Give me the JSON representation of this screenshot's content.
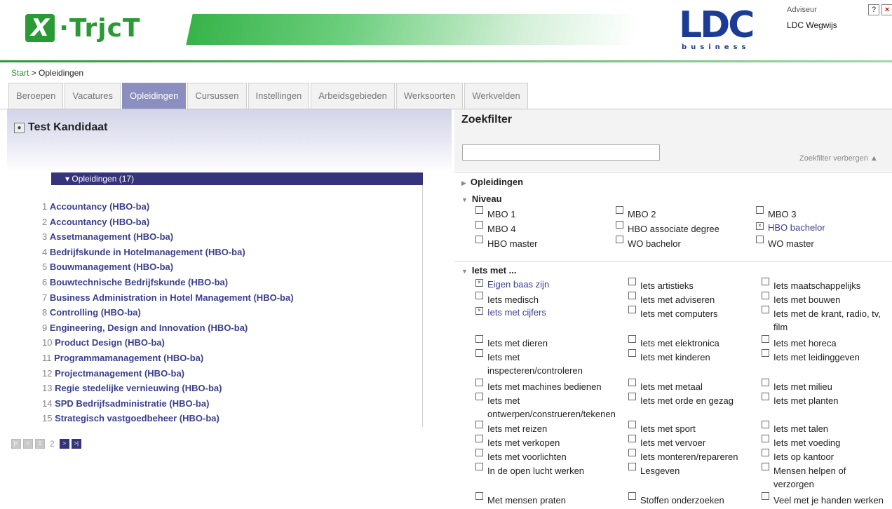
{
  "header": {
    "logo_mark": "X",
    "logo_text": "·TrjcT",
    "partner_logo": "LDC",
    "partner_sub": "business",
    "adviseur_label": "Adviseur",
    "adviseur_name": "LDC Wegwijs",
    "help_label": "?",
    "close_label": "×"
  },
  "breadcrumb": {
    "start": "Start",
    "sep": " > ",
    "current": "Opleidingen"
  },
  "tabs": [
    "Beroepen",
    "Vacatures",
    "Opleidingen",
    "Cursussen",
    "Instellingen",
    "Arbeidsgebieden",
    "Werksoorten",
    "Werkvelden"
  ],
  "active_tab": "Opleidingen",
  "candidate": {
    "name": "Test Kandidaat"
  },
  "results": {
    "header": "▾ Opleidingen (17)",
    "items": [
      {
        "n": "1",
        "label": "Accountancy (HBO-ba)"
      },
      {
        "n": "2",
        "label": "Accountancy (HBO-ba)"
      },
      {
        "n": "3",
        "label": "Assetmanagement (HBO-ba)"
      },
      {
        "n": "4",
        "label": "Bedrijfskunde in Hotelmanagement (HBO-ba)"
      },
      {
        "n": "5",
        "label": "Bouwmanagement (HBO-ba)"
      },
      {
        "n": "6",
        "label": "Bouwtechnische Bedrijfskunde (HBO-ba)"
      },
      {
        "n": "7",
        "label": "Business Administration in Hotel Management (HBO-ba)"
      },
      {
        "n": "8",
        "label": "Controlling (HBO-ba)"
      },
      {
        "n": "9",
        "label": "Engineering, Design and Innovation (HBO-ba)"
      },
      {
        "n": "10",
        "label": "Product Design (HBO-ba)"
      },
      {
        "n": "11",
        "label": "Programmamanagement (HBO-ba)"
      },
      {
        "n": "12",
        "label": "Projectmanagement (HBO-ba)"
      },
      {
        "n": "13",
        "label": "Regie stedelijke vernieuwing (HBO-ba)"
      },
      {
        "n": "14",
        "label": "SPD Bedrijfsadministratie (HBO-ba)"
      },
      {
        "n": "15",
        "label": "Strategisch vastgoedbeheer (HBO-ba)"
      }
    ]
  },
  "pager": {
    "page1": "1",
    "page2": "2"
  },
  "zoekfilter": {
    "title": "Zoekfilter",
    "search_value": "",
    "hide_label": "Zoekfilter verbergen",
    "sections": {
      "opleidingen": "Opleidingen",
      "niveau": "Niveau",
      "iets_met": "Iets met ..."
    },
    "niveau": [
      {
        "label": "MBO 1",
        "checked": false
      },
      {
        "label": "MBO 2",
        "checked": false
      },
      {
        "label": "MBO 3",
        "checked": false
      },
      {
        "label": "MBO 4",
        "checked": false
      },
      {
        "label": "HBO associate degree",
        "checked": false
      },
      {
        "label": "HBO bachelor",
        "checked": true
      },
      {
        "label": "HBO master",
        "checked": false
      },
      {
        "label": "WO bachelor",
        "checked": false
      },
      {
        "label": "WO master",
        "checked": false
      }
    ],
    "iets_met": [
      {
        "label": "Eigen baas zijn",
        "checked": true
      },
      {
        "label": "Iets artistieks",
        "checked": false
      },
      {
        "label": "Iets maatschappelijks",
        "checked": false
      },
      {
        "label": "Iets medisch",
        "checked": false
      },
      {
        "label": "Iets met adviseren",
        "checked": false
      },
      {
        "label": "Iets met bouwen",
        "checked": false
      },
      {
        "label": "Iets met cijfers",
        "checked": true
      },
      {
        "label": "Iets met computers",
        "checked": false
      },
      {
        "label": "Iets met de krant, radio, tv,",
        "label2": "film",
        "checked": false
      },
      {
        "label": "Iets met dieren",
        "checked": false
      },
      {
        "label": "Iets met elektronica",
        "checked": false
      },
      {
        "label": "Iets met horeca",
        "checked": false
      },
      {
        "label": "Iets met",
        "label2": "inspecteren/controleren",
        "checked": false
      },
      {
        "label": "Iets met kinderen",
        "checked": false
      },
      {
        "label": "Iets met leidinggeven",
        "checked": false
      },
      {
        "label": "Iets met machines bedienen",
        "checked": false
      },
      {
        "label": "Iets met metaal",
        "checked": false
      },
      {
        "label": "Iets met milieu",
        "checked": false
      },
      {
        "label": "Iets met",
        "label2": "ontwerpen/construeren/tekenen",
        "checked": false
      },
      {
        "label": "Iets met orde en gezag",
        "checked": false
      },
      {
        "label": "Iets met planten",
        "checked": false
      },
      {
        "label": "Iets met reizen",
        "checked": false
      },
      {
        "label": "Iets met sport",
        "checked": false
      },
      {
        "label": "Iets met talen",
        "checked": false
      },
      {
        "label": "Iets met verkopen",
        "checked": false
      },
      {
        "label": "Iets met vervoer",
        "checked": false
      },
      {
        "label": "Iets met voeding",
        "checked": false
      },
      {
        "label": "Iets met voorlichten",
        "checked": false
      },
      {
        "label": "Iets monteren/repareren",
        "checked": false
      },
      {
        "label": "Iets op kantoor",
        "checked": false
      },
      {
        "label": "In de open lucht werken",
        "checked": false
      },
      {
        "label": "Lesgeven",
        "checked": false
      },
      {
        "label": "Mensen helpen of",
        "label2": "verzorgen",
        "checked": false
      },
      {
        "label": "Met mensen praten",
        "checked": false
      },
      {
        "label": "Stoffen onderzoeken",
        "checked": false
      },
      {
        "label": "Veel met je handen werken",
        "checked": false
      }
    ]
  },
  "colors": {
    "brand_green": "#2a9a36",
    "active_tab": "#8a8fc0",
    "list_header": "#35337a",
    "link": "#3a3f8f",
    "ldc_blue": "#1b3b94"
  }
}
